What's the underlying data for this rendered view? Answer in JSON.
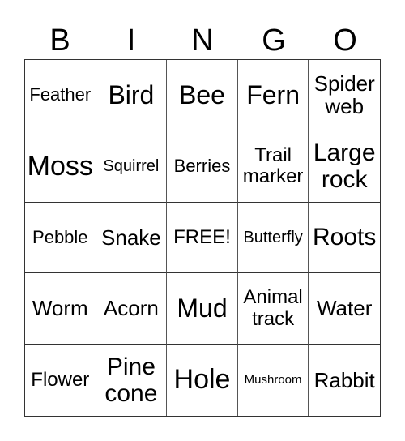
{
  "title_letters": [
    "B",
    "I",
    "N",
    "G",
    "O"
  ],
  "cells": [
    [
      "Feather",
      "Bird",
      "Bee",
      "Fern",
      "Spider web"
    ],
    [
      "Moss",
      "Squirrel",
      "Berries",
      "Trail marker",
      "Large rock"
    ],
    [
      "Pebble",
      "Snake",
      "FREE!",
      "Butterfly",
      "Roots"
    ],
    [
      "Worm",
      "Acorn",
      "Mud",
      "Animal track",
      "Water"
    ],
    [
      "Flower",
      "Pine cone",
      "Hole",
      "Mushroom",
      "Rabbit"
    ]
  ]
}
